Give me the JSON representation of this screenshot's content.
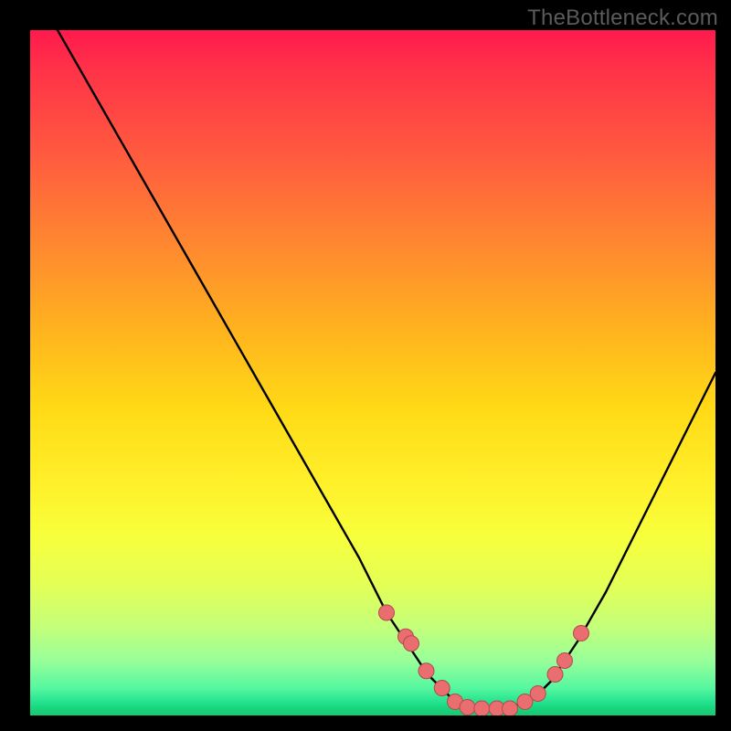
{
  "watermark": "TheBottleneck.com",
  "colors": {
    "background": "#000000",
    "curve": "#000000",
    "marker_fill": "#ea6d6f",
    "marker_stroke": "#b04c4e",
    "gradient_top": "#ff1a4d",
    "gradient_mid": "#fff02a",
    "gradient_bottom": "#18c96e"
  },
  "chart_data": {
    "type": "line",
    "title": "",
    "xlabel": "",
    "ylabel": "",
    "xlim": [
      0,
      100
    ],
    "ylim": [
      0,
      100
    ],
    "grid": false,
    "legend": false,
    "series": [
      {
        "name": "bottleneck-curve",
        "x": [
          0,
          4,
          8,
          12,
          16,
          20,
          24,
          28,
          32,
          36,
          40,
          44,
          48,
          52,
          54,
          56,
          58,
          60,
          62,
          64,
          66,
          68,
          70,
          72,
          74,
          76,
          78,
          80,
          84,
          88,
          92,
          96,
          100
        ],
        "y": [
          106,
          100,
          93,
          86,
          79,
          72,
          65,
          58,
          51,
          44,
          37,
          30,
          23,
          15,
          12,
          9,
          6,
          4,
          2,
          1,
          1,
          1,
          1,
          2,
          3,
          5,
          8,
          11,
          18,
          26,
          34,
          42,
          50
        ]
      }
    ],
    "markers": {
      "name": "highlight-points",
      "x": [
        52.0,
        54.8,
        55.6,
        57.8,
        60.1,
        62.0,
        63.8,
        65.9,
        68.1,
        70.0,
        72.2,
        74.1,
        76.6,
        78.0,
        80.4
      ],
      "y": [
        15.0,
        11.5,
        10.5,
        6.5,
        4.0,
        2.0,
        1.2,
        1.0,
        1.0,
        1.0,
        2.0,
        3.2,
        6.0,
        8.0,
        12.0
      ]
    }
  }
}
